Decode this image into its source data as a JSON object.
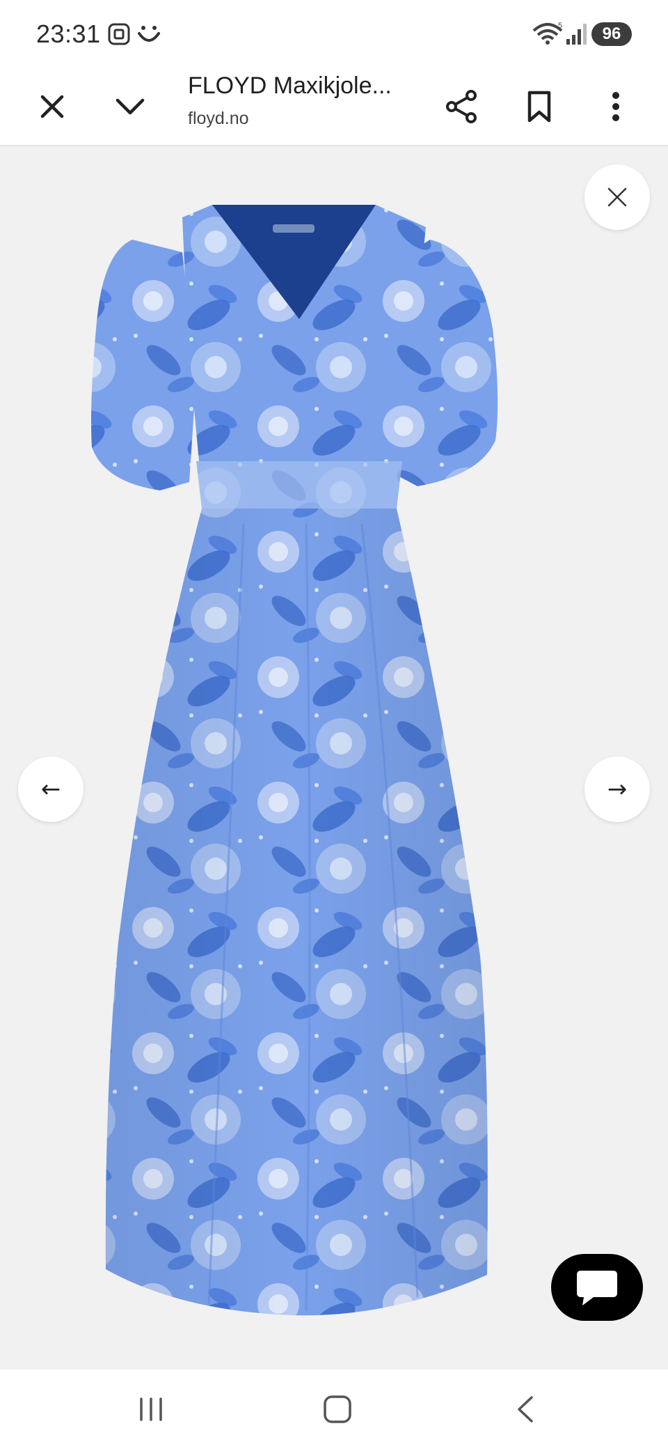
{
  "status_bar": {
    "time": "23:31",
    "battery": "96",
    "icons": [
      "screenshot-icon",
      "smile-icon",
      "wifi-icon",
      "signal-icon"
    ]
  },
  "toolbar": {
    "title": "FLOYD Maxikjole...",
    "domain": "floyd.no",
    "icons": [
      "close-icon",
      "chevron-down-icon",
      "share-icon",
      "bookmark-icon",
      "more-icon"
    ]
  },
  "viewer": {
    "prev_arrow": "←",
    "next_arrow": "→",
    "image_alt": "Blue floral maxi dress",
    "colors": {
      "background": "#f1f1f2",
      "dress_base": "#7aa1ea",
      "dress_dark": "#2d5fc5",
      "dress_light": "#c9d8f7",
      "neckline": "#1c3f8e"
    }
  },
  "nav_bar": {
    "icons": [
      "recent-apps-icon",
      "home-icon",
      "back-icon"
    ]
  }
}
